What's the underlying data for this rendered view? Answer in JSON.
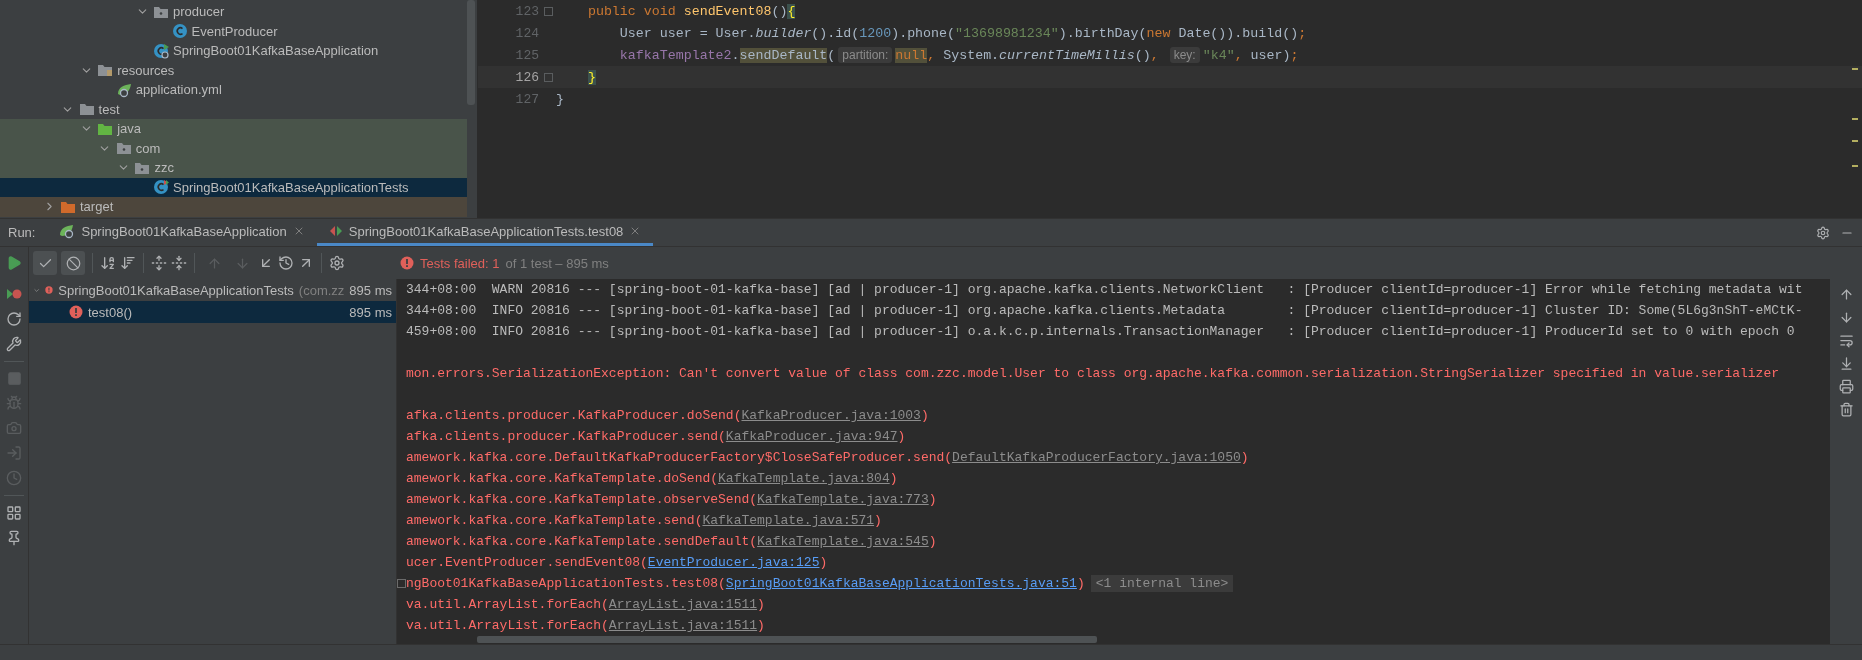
{
  "project_tree": [
    {
      "children": [
        {
          "children": [
            {
              "children": [
                {
                  "children": [
                    {
                      "children": [
                        {
                          "label": "producer",
                          "kind": "package",
                          "expanded": true,
                          "selected": false,
                          "test_scope": false,
                          "children": [
                            {
                              "label": "EventProducer",
                              "kind": "class",
                              "selected": false,
                              "test_scope": false
                            }
                          ]
                        },
                        {
                          "label": "SpringBoot01KafkaBaseApplication",
                          "kind": "app-class",
                          "selected": false,
                          "test_scope": false
                        }
                      ]
                    }
                  ]
                }
              ]
            },
            {
              "label": "resources",
              "kind": "resources",
              "expanded": true,
              "selected": false,
              "test_scope": false,
              "children": [
                {
                  "label": "application.yml",
                  "kind": "config",
                  "selected": false,
                  "test_scope": false
                }
              ]
            }
          ]
        },
        {
          "label": "test",
          "kind": "folder",
          "expanded": true,
          "selected": false,
          "test_scope": false,
          "children": [
            {
              "label": "java",
              "kind": "test-root",
              "expanded": true,
              "selected": false,
              "test_scope": true,
              "children": [
                {
                  "label": "com",
                  "kind": "package",
                  "expanded": true,
                  "selected": false,
                  "test_scope": true,
                  "children": [
                    {
                      "label": "zzc",
                      "kind": "package",
                      "expanded": true,
                      "selected": false,
                      "test_scope": true,
                      "children": [
                        {
                          "label": "SpringBoot01KafkaBaseApplicationTests",
                          "kind": "test-class",
                          "selected": true
                        }
                      ]
                    }
                  ]
                }
              ]
            }
          ]
        }
      ]
    },
    {
      "label": "target",
      "kind": "excluded",
      "expanded": false,
      "selected": false
    }
  ],
  "editor": {
    "lines": [
      {
        "number": "123",
        "current": false,
        "fold": true,
        "tokens": [
          {
            "text": "    public void ",
            "kind": "keyword"
          },
          {
            "text": "sendEvent08",
            "kind": "method"
          },
          {
            "text": "()",
            "kind": "plain"
          },
          {
            "text": "{",
            "kind": "brace",
            "highlighted": true
          }
        ]
      },
      {
        "number": "124",
        "current": false,
        "fold": false,
        "tokens": [
          {
            "text": "        User user = User.",
            "kind": "plain"
          },
          {
            "text": "builder",
            "kind": "static"
          },
          {
            "text": "().id(",
            "kind": "plain"
          },
          {
            "text": "1200",
            "kind": "number"
          },
          {
            "text": ").phone(",
            "kind": "plain"
          },
          {
            "text": "\"13698981234\"",
            "kind": "string"
          },
          {
            "text": ").birthDay(",
            "kind": "plain"
          },
          {
            "text": "new ",
            "kind": "keyword"
          },
          {
            "text": "Date()).build()",
            "kind": "plain"
          },
          {
            "text": ";",
            "kind": "keyword"
          }
        ]
      },
      {
        "number": "125",
        "current": false,
        "fold": false,
        "tokens": [
          {
            "text": "        kafkaTemplate2",
            "kind": "field"
          },
          {
            "text": ".",
            "kind": "plain"
          },
          {
            "text": "sendDefault",
            "kind": "plain",
            "highlighted": true
          },
          {
            "text": "(",
            "kind": "plain"
          },
          {
            "text": "partition:",
            "kind": "hint"
          },
          {
            "text": "null",
            "kind": "keyword",
            "highlighted": true
          },
          {
            "text": ", ",
            "kind": "keyword"
          },
          {
            "text": "System.",
            "kind": "plain"
          },
          {
            "text": "currentTimeMillis",
            "kind": "static"
          },
          {
            "text": "()",
            "kind": "plain"
          },
          {
            "text": ", ",
            "kind": "keyword"
          },
          {
            "text": "key:",
            "kind": "hint"
          },
          {
            "text": "\"k4\"",
            "kind": "string"
          },
          {
            "text": ", ",
            "kind": "keyword"
          },
          {
            "text": "user)",
            "kind": "plain"
          },
          {
            "text": ";",
            "kind": "keyword"
          }
        ]
      },
      {
        "number": "126",
        "current": true,
        "fold": true,
        "tokens": [
          {
            "text": "    }",
            "kind": "brace",
            "highlighted": true
          }
        ]
      },
      {
        "number": "127",
        "current": false,
        "fold": false,
        "tokens": [
          {
            "text": "}",
            "kind": "plain"
          }
        ]
      }
    ]
  },
  "run_bar": {
    "label": "Run:",
    "tabs": [
      {
        "label": "SpringBoot01KafkaBaseApplication",
        "kind": "app",
        "selected": false
      },
      {
        "label": "SpringBoot01KafkaBaseApplicationTests.test08",
        "kind": "test",
        "selected": true
      }
    ]
  },
  "toolbar": {
    "toggles": [
      {
        "on": true
      },
      {
        "on": true
      }
    ],
    "nav_buttons": [
      {
        "disabled": true
      },
      {
        "disabled": true
      }
    ]
  },
  "status": {
    "failed": "Tests failed: 1",
    "rest": "of 1 test – 895 ms"
  },
  "test_tree": [
    {
      "label": "SpringBoot01KafkaBaseApplicationTests",
      "package": "(com.zz",
      "time": "895 ms",
      "failed": true,
      "expanded": true,
      "selected": false,
      "children": [
        {
          "label": "test08()",
          "time": "895 ms",
          "failed": true,
          "selected": true
        }
      ]
    }
  ],
  "console": [
    {
      "kind": "log",
      "text": "344+08:00  WARN 20816 --- [spring-boot-01-kafka-base] [ad | producer-1] org.apache.kafka.clients.NetworkClient   : [Producer clientId=producer-1] Error while fetching metadata wit"
    },
    {
      "kind": "log",
      "text": "344+08:00  INFO 20816 --- [spring-boot-01-kafka-base] [ad | producer-1] org.apache.kafka.clients.Metadata        : [Producer clientId=producer-1] Cluster ID: Some(5L6g3nShT-eMCtK-"
    },
    {
      "kind": "log",
      "text": "459+08:00  INFO 20816 --- [spring-boot-01-kafka-base] [ad | producer-1] o.a.k.c.p.internals.TransactionManager   : [Producer clientId=producer-1] ProducerId set to 0 with epoch 0"
    },
    {
      "kind": "blank"
    },
    {
      "kind": "error",
      "text": "mon.errors.SerializationException: Can't convert value of class com.zzc.model.User to class org.apache.kafka.common.serialization.StringSerializer specified in value.serializer"
    },
    {
      "kind": "blank"
    },
    {
      "kind": "stack",
      "text": "afka.clients.producer.KafkaProducer.doSend(",
      "link": "KafkaProducer.java:1003",
      "in_project": false,
      "end": ")"
    },
    {
      "kind": "stack",
      "text": "afka.clients.producer.KafkaProducer.send(",
      "link": "KafkaProducer.java:947",
      "in_project": false,
      "end": ")"
    },
    {
      "kind": "stack",
      "text": "amework.kafka.core.DefaultKafkaProducerFactory$CloseSafeProducer.send(",
      "link": "DefaultKafkaProducerFactory.java:1050",
      "in_project": false,
      "end": ")"
    },
    {
      "kind": "stack",
      "text": "amework.kafka.core.KafkaTemplate.doSend(",
      "link": "KafkaTemplate.java:804",
      "in_project": false,
      "end": ")"
    },
    {
      "kind": "stack",
      "text": "amework.kafka.core.KafkaTemplate.observeSend(",
      "link": "KafkaTemplate.java:773",
      "in_project": false,
      "end": ")"
    },
    {
      "kind": "stack",
      "text": "amework.kafka.core.KafkaTemplate.send(",
      "link": "KafkaTemplate.java:571",
      "in_project": false,
      "end": ")"
    },
    {
      "kind": "stack",
      "text": "amework.kafka.core.KafkaTemplate.sendDefault(",
      "link": "KafkaTemplate.java:545",
      "in_project": false,
      "end": ")"
    },
    {
      "kind": "stack",
      "text": "ucer.EventProducer.sendEvent08(",
      "link": "EventProducer.java:125",
      "in_project": true,
      "end": ")"
    },
    {
      "kind": "stack",
      "text": "ngBoot01KafkaBaseApplicationTests.test08(",
      "link": "SpringBoot01KafkaBaseApplicationTests.java:51",
      "in_project": true,
      "end": ")",
      "folded": true,
      "note": "<1 internal line>"
    },
    {
      "kind": "stack",
      "text": "va.util.ArrayList.forEach(",
      "link": "ArrayList.java:1511",
      "in_project": false,
      "end": ")"
    },
    {
      "kind": "stack",
      "text": "va.util.ArrayList.forEach(",
      "link": "ArrayList.java:1511",
      "in_project": false,
      "end": ")"
    }
  ]
}
